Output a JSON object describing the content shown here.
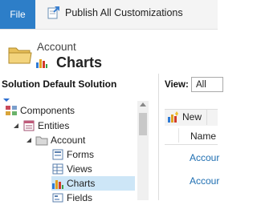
{
  "ribbon": {
    "file_label": "File",
    "publish_label": "Publish All Customizations"
  },
  "header": {
    "entity_name": "Account",
    "page_title": "Charts"
  },
  "left_pane": {
    "solution_label": "Solution Default Solution",
    "tree": [
      {
        "label": "Components"
      },
      {
        "label": "Entities"
      },
      {
        "label": "Account"
      },
      {
        "label": "Forms"
      },
      {
        "label": "Views"
      },
      {
        "label": "Charts",
        "selected": true
      },
      {
        "label": "Fields"
      }
    ]
  },
  "right_pane": {
    "view_label": "View:",
    "view_value": "All",
    "new_label": "New",
    "column_name": "Name",
    "rows": [
      "Accour",
      "Accour"
    ]
  },
  "colors": {
    "file_tab": "#2d7ec8",
    "selected_row": "#cde6f7",
    "link": "#1f6fb2"
  }
}
